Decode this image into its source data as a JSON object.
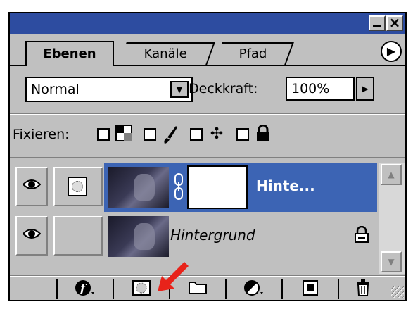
{
  "window": {
    "minimize_label": "▁",
    "close_label": "×",
    "title_color": "#2d4ca0"
  },
  "tabs": [
    {
      "label": "Ebenen",
      "active": true
    },
    {
      "label": "Kanäle",
      "active": false
    },
    {
      "label": "Pfad",
      "active": false
    }
  ],
  "blend": {
    "mode": "Normal",
    "opacity_label": "Deckkraft:",
    "opacity_value": "100%"
  },
  "lock": {
    "label": "Fixieren:"
  },
  "layers": [
    {
      "name": "Hinte...",
      "selected": true,
      "has_mask": true,
      "visible": true
    },
    {
      "name": "Hintergrund",
      "selected": false,
      "has_mask": false,
      "visible": true,
      "locked": true
    }
  ],
  "colors": {
    "selection": "#3c64b4",
    "panel": "#c0c0c0",
    "arrow": "#e8231a"
  },
  "icons": {
    "eye": "eye-icon",
    "link": "chain-link-icon",
    "lock": "lock-icon",
    "fx": "layer-style-icon",
    "mask": "add-mask-icon",
    "folder": "new-set-icon",
    "adjust": "adjustment-layer-icon",
    "new": "new-layer-icon",
    "trash": "trash-icon"
  }
}
